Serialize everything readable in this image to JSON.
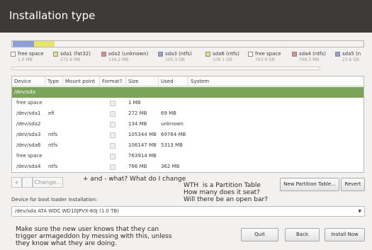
{
  "header": {
    "title": "Installation type"
  },
  "partition_bar": {
    "segments": [
      {
        "name": "free space",
        "color": "#ffffff",
        "weight": 1
      },
      {
        "name": "sda1",
        "color": "#8c9fd9",
        "weight": 30
      },
      {
        "name": "sda6",
        "color": "#e9e56b",
        "weight": 30
      },
      {
        "name": "rest",
        "color": "#f4f3f1",
        "weight": 439
      }
    ]
  },
  "legend": [
    {
      "label": "free space",
      "size": "1.0 MB",
      "color": "#ffffff"
    },
    {
      "label": "sda1 (fat32)",
      "size": "272.6 MB",
      "color": "#e9e56b"
    },
    {
      "label": "sda2 (unknown)",
      "size": "134.2 MB",
      "color": "#e2898a"
    },
    {
      "label": "sda3 (ntfs)",
      "size": "105.3 GB",
      "color": "#8c9fd9"
    },
    {
      "label": "sda6 (ntfs)",
      "size": "106.1 GB",
      "color": "#e9e56b"
    },
    {
      "label": "free space",
      "size": "763.9 GB",
      "color": "#ffffff"
    },
    {
      "label": "sda4 (ntfs)",
      "size": "766.5 MB",
      "color": "#e2898a"
    },
    {
      "label": "sda5 (n",
      "size": "23.6 GB",
      "color": "#8c9fd9"
    }
  ],
  "table": {
    "columns": [
      "Device",
      "Type",
      "Mount point",
      "Format?",
      "Size",
      "Used",
      "System"
    ],
    "rows": [
      {
        "device": "/dev/sda",
        "type": "",
        "mount": "",
        "format": false,
        "size": "",
        "used": "",
        "system": "",
        "selected": true,
        "is_disk": true
      },
      {
        "device": "free space",
        "type": "",
        "mount": "",
        "format": true,
        "size": "1 MB",
        "used": "",
        "system": ""
      },
      {
        "device": "/dev/sda1",
        "type": "efi",
        "mount": "",
        "format": true,
        "size": "272 MB",
        "used": "69 MB",
        "system": ""
      },
      {
        "device": "/dev/sda2",
        "type": "",
        "mount": "",
        "format": true,
        "size": "134 MB",
        "used": "unknown",
        "system": ""
      },
      {
        "device": "/dev/sda3",
        "type": "ntfs",
        "mount": "",
        "format": true,
        "size": "105344 MB",
        "used": "69764 MB",
        "system": ""
      },
      {
        "device": "/dev/sda6",
        "type": "ntfs",
        "mount": "",
        "format": true,
        "size": "106147 MB",
        "used": "5313 MB",
        "system": ""
      },
      {
        "device": "free space",
        "type": "",
        "mount": "",
        "format": true,
        "size": "763914 MB",
        "used": "",
        "system": ""
      },
      {
        "device": "/dev/sda4",
        "type": "ntfs",
        "mount": "",
        "format": true,
        "size": "766 MB",
        "used": "362 MB",
        "system": ""
      }
    ]
  },
  "toolbar": {
    "add_label": "+",
    "remove_label": "-",
    "change_label": "Change...",
    "new_table_label": "New Partition Table...",
    "revert_label": "Revert"
  },
  "annotations": {
    "add_remove_note": "+ and - what? What do I change",
    "partition_table_note": "WTH  is a Partition Table\nHow many does it seat?\nWill there be an open bar?",
    "bottom_note": "Make sure the new user knows that they can\ntrigger armageddon by messing with this, unless\nthey know what they are doing."
  },
  "bootloader": {
    "label": "Device for boot loader installation:",
    "value": "/dev/sda   ATA WDC WD10JPVX-60J (1.0 TB)"
  },
  "buttons": {
    "quit": "Quit",
    "back": "Back",
    "install": "Install Now"
  }
}
